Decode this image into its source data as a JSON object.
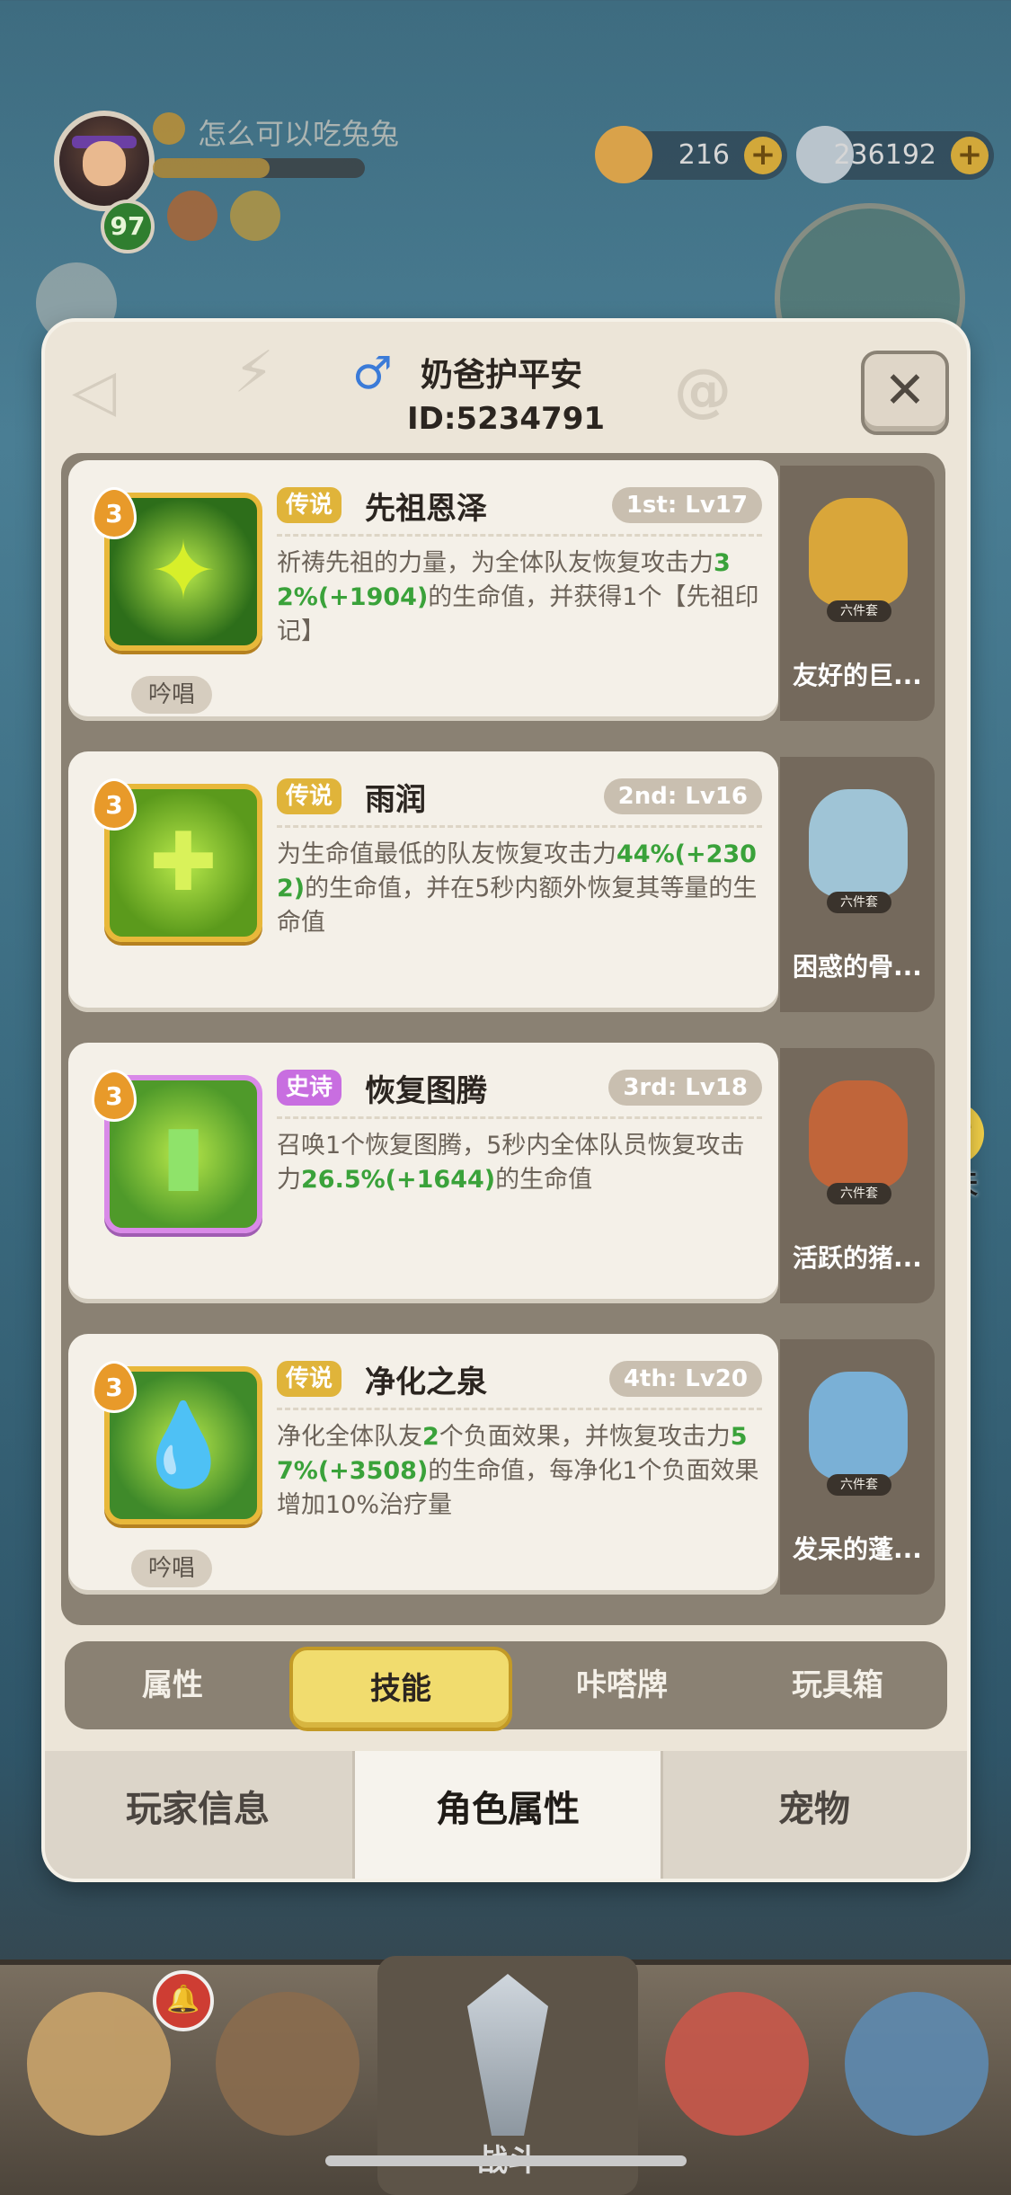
{
  "hud": {
    "player_name": "怎么可以吃兔兔",
    "level": "97",
    "exp_fraction": 0.55,
    "currency_1": "216",
    "currency_2": "236192",
    "plus": "+"
  },
  "chat_float": {
    "label": "聊天"
  },
  "modal": {
    "gender_symbol": "♂",
    "name": "奶爸护平安",
    "id_text": "ID:5234791",
    "close_symbol": "✕",
    "skills": [
      {
        "level": "3",
        "rarity": "传说",
        "name": "先祖恩泽",
        "slot": "1st: Lv17",
        "desc_parts": [
          "祈祷先祖的力量，为全体队友恢复攻击力",
          "32%(+1904)",
          "的生命值，并获得1个【先祖印记】"
        ],
        "chant": "吟唱",
        "pet_tag": "六件套",
        "pet_name": "友好的巨...",
        "icon_color": "#2d6e1a"
      },
      {
        "level": "3",
        "rarity": "传说",
        "name": "雨润",
        "slot": "2nd: Lv16",
        "desc_parts": [
          "为生命值最低的队友恢复攻击力",
          "44%(+2302)",
          "的生命值，并在5秒内额外恢复其等量的生命值"
        ],
        "chant": "",
        "pet_tag": "六件套",
        "pet_name": "困惑的骨...",
        "icon_color": "#5b9a1c"
      },
      {
        "level": "3",
        "rarity": "史诗",
        "name": "恢复图腾",
        "slot": "3rd: Lv18",
        "desc_parts": [
          "召唤1个恢复图腾，5秒内全体队员恢复攻击力",
          "26.5%(+1644)",
          "的生命值"
        ],
        "chant": "",
        "pet_tag": "六件套",
        "pet_name": "活跃的猪...",
        "icon_color": "#4f9a2a"
      },
      {
        "level": "3",
        "rarity": "传说",
        "name": "净化之泉",
        "slot": "4th: Lv20",
        "desc_parts": [
          "净化全体队友",
          "2",
          "个负面效果，并恢复攻击力",
          "57%(+3508)",
          "的生命值，每净化1个负面效果增加10%治疗量"
        ],
        "chant": "吟唱",
        "pet_tag": "六件套",
        "pet_name": "发呆的蓬...",
        "icon_color": "#3f8a2a"
      }
    ],
    "subtabs": [
      "属性",
      "技能",
      "咔嗒牌",
      "玩具箱"
    ],
    "subtab_active": 1,
    "maintabs": [
      "玩家信息",
      "角色属性",
      "宠物"
    ],
    "maintab_active": 1
  },
  "bottom_nav": {
    "center_label": "战斗",
    "notify_symbol": "🔔"
  },
  "colors": {
    "accent_yellow": "#f1dc6e",
    "legend": "#e0b43a",
    "epic": "#c86ee0",
    "green_value": "#3aa23a"
  }
}
